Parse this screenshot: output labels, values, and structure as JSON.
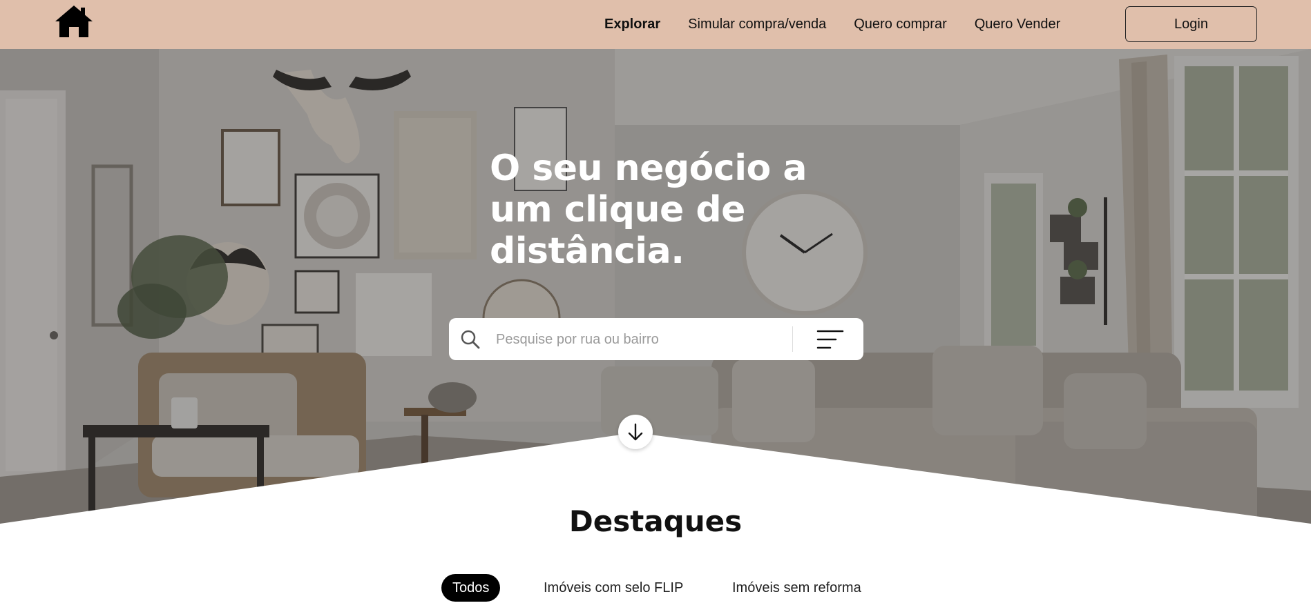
{
  "header": {
    "logo_icon": "house-icon",
    "nav": [
      {
        "label": "Explorar",
        "active": true
      },
      {
        "label": "Simular compra/venda",
        "active": false
      },
      {
        "label": "Quero comprar",
        "active": false
      },
      {
        "label": "Quero Vender",
        "active": false
      }
    ],
    "login_label": "Login",
    "background_color": "#e0bfab"
  },
  "hero": {
    "title_lines": [
      "O seu negócio a",
      "um clique de",
      "distância."
    ],
    "search": {
      "placeholder": "Pesquise por rua ou bairro",
      "value": "",
      "search_icon": "search-icon",
      "filter_icon": "filter-lines-icon"
    },
    "scroll_icon": "arrow-down-icon"
  },
  "highlights": {
    "title": "Destaques",
    "tabs": [
      {
        "label": "Todos",
        "active": true
      },
      {
        "label": "Imóveis com selo FLIP",
        "active": false
      },
      {
        "label": "Imóveis sem reforma",
        "active": false
      }
    ]
  }
}
